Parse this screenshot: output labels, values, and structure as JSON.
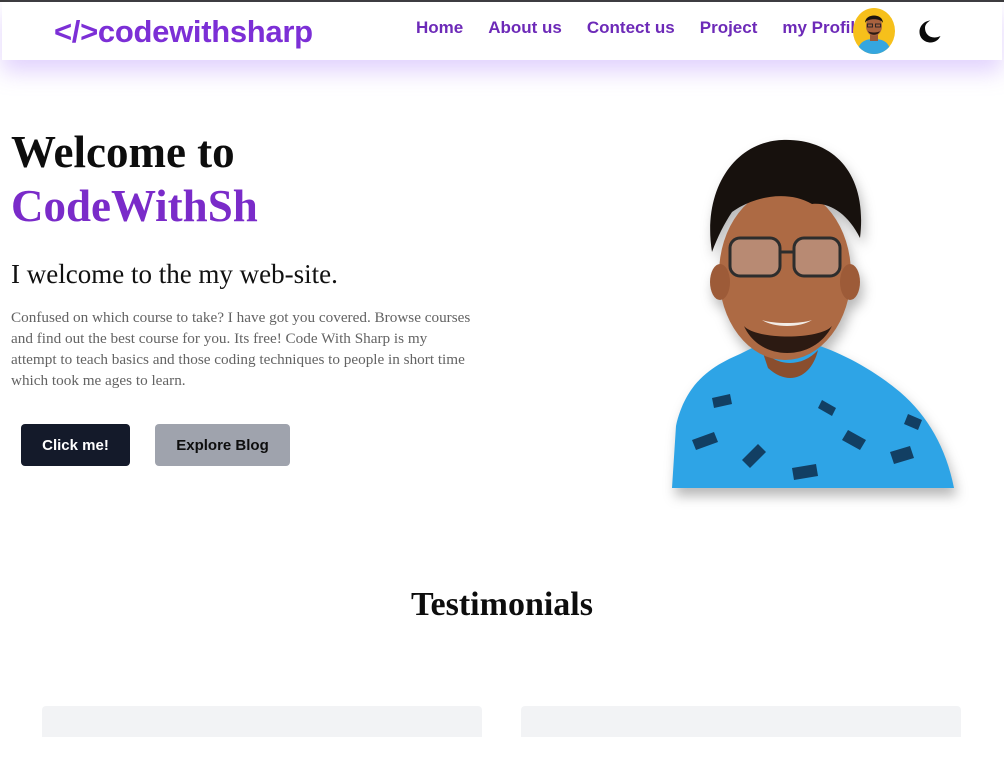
{
  "header": {
    "logo": "</>codewithsharp",
    "nav": [
      "Home",
      "About us",
      "Contect us",
      "Project",
      "my Profile"
    ]
  },
  "hero": {
    "title_line1": "Welcome to",
    "title_line2": "CodeWithSh",
    "subtitle": "I welcome to the my web-site.",
    "description": "Confused on which course to take? I have got you covered. Browse courses and find out the best course for you. Its free! Code With Sharp is my attempt to teach basics and those coding techniques to people in short time which took me ages to learn.",
    "primary_button": "Click me!",
    "secondary_button": "Explore Blog"
  },
  "testimonials": {
    "title": "Testimonials"
  },
  "colors": {
    "accent": "#7a2bc9",
    "nav_text": "#6d2ab8",
    "primary_button": "#141a2a",
    "secondary_button": "#9fa3ad",
    "avatar_bg": "#f6c01b",
    "card_bg": "#f2f3f5"
  },
  "icons": [
    "profile-avatar",
    "moon-icon"
  ]
}
